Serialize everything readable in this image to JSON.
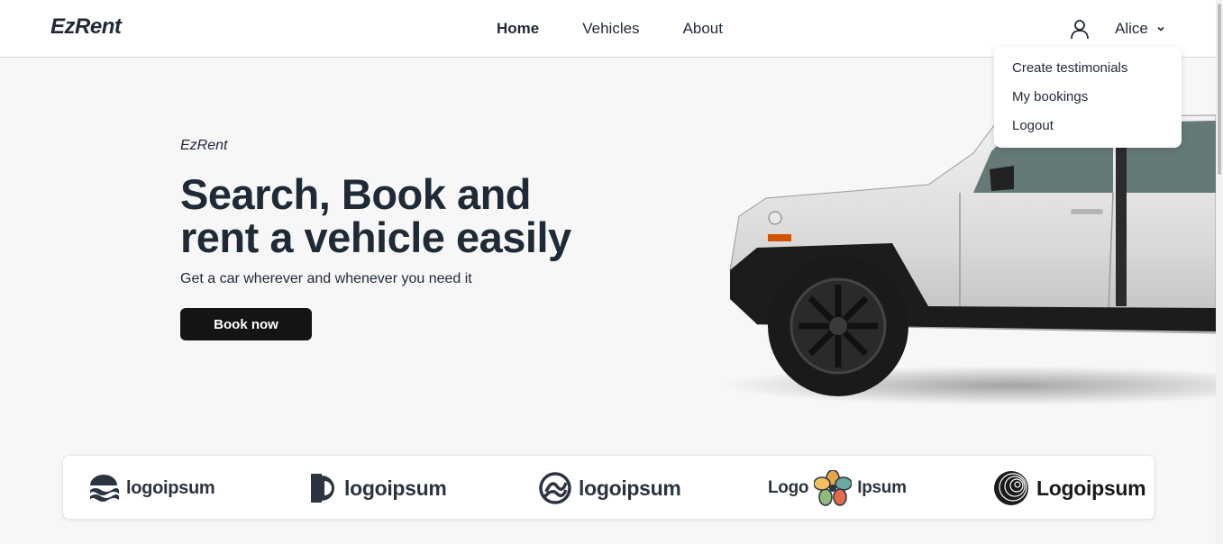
{
  "header": {
    "brand": "EzRent",
    "nav": [
      {
        "label": "Home",
        "active": true
      },
      {
        "label": "Vehicles",
        "active": false
      },
      {
        "label": "About",
        "active": false
      }
    ],
    "user": {
      "name": "Alice",
      "icon": "user-icon"
    }
  },
  "dropdown": {
    "items": [
      "Create testimonials",
      "My bookings",
      "Logout"
    ]
  },
  "hero": {
    "kicker": "EzRent",
    "title_line1": "Search, Book and",
    "title_line2": "rent a vehicle easily",
    "subtitle": "Get a car wherever and whenever you need it",
    "cta": "Book now"
  },
  "logos": [
    {
      "text": "logoipsum",
      "icon": "waves-logo-icon"
    },
    {
      "text": "logoipsum",
      "icon": "half-circle-logo-icon"
    },
    {
      "text": "logoipsum",
      "icon": "swirl-logo-icon"
    },
    {
      "text_left": "Logo",
      "text_right": "Ipsum",
      "icon": "flower-logo-icon"
    },
    {
      "text": "Logoipsum",
      "icon": "concentric-logo-icon"
    }
  ],
  "colors": {
    "background": "#f7f7f7",
    "text": "#1f2937",
    "cta_bg": "#141414"
  }
}
